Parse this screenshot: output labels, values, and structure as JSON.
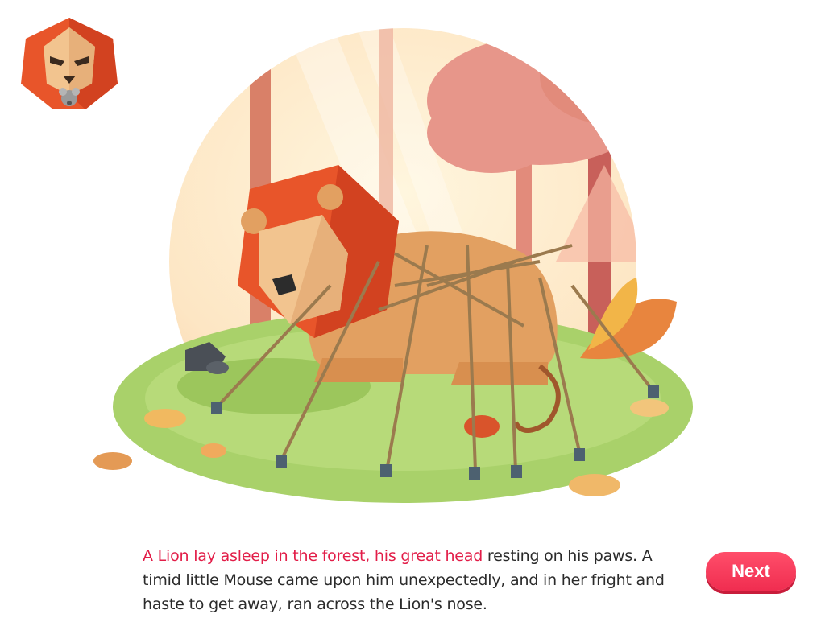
{
  "story": {
    "highlight": "A Lion lay asleep in the forest, his great head",
    "text": " resting on his paws. A timid little Mouse came upon him unexpectedly, and in her fright and haste to get away, ran across the Lion's nose."
  },
  "controls": {
    "next_label": "Next"
  },
  "icons": {
    "logo": "lion-with-mouse-logo-icon"
  },
  "colors": {
    "accent": "#e21d48",
    "next_button": "#f6304f",
    "mane": "#e8552a",
    "grass": "#a9d16a"
  }
}
